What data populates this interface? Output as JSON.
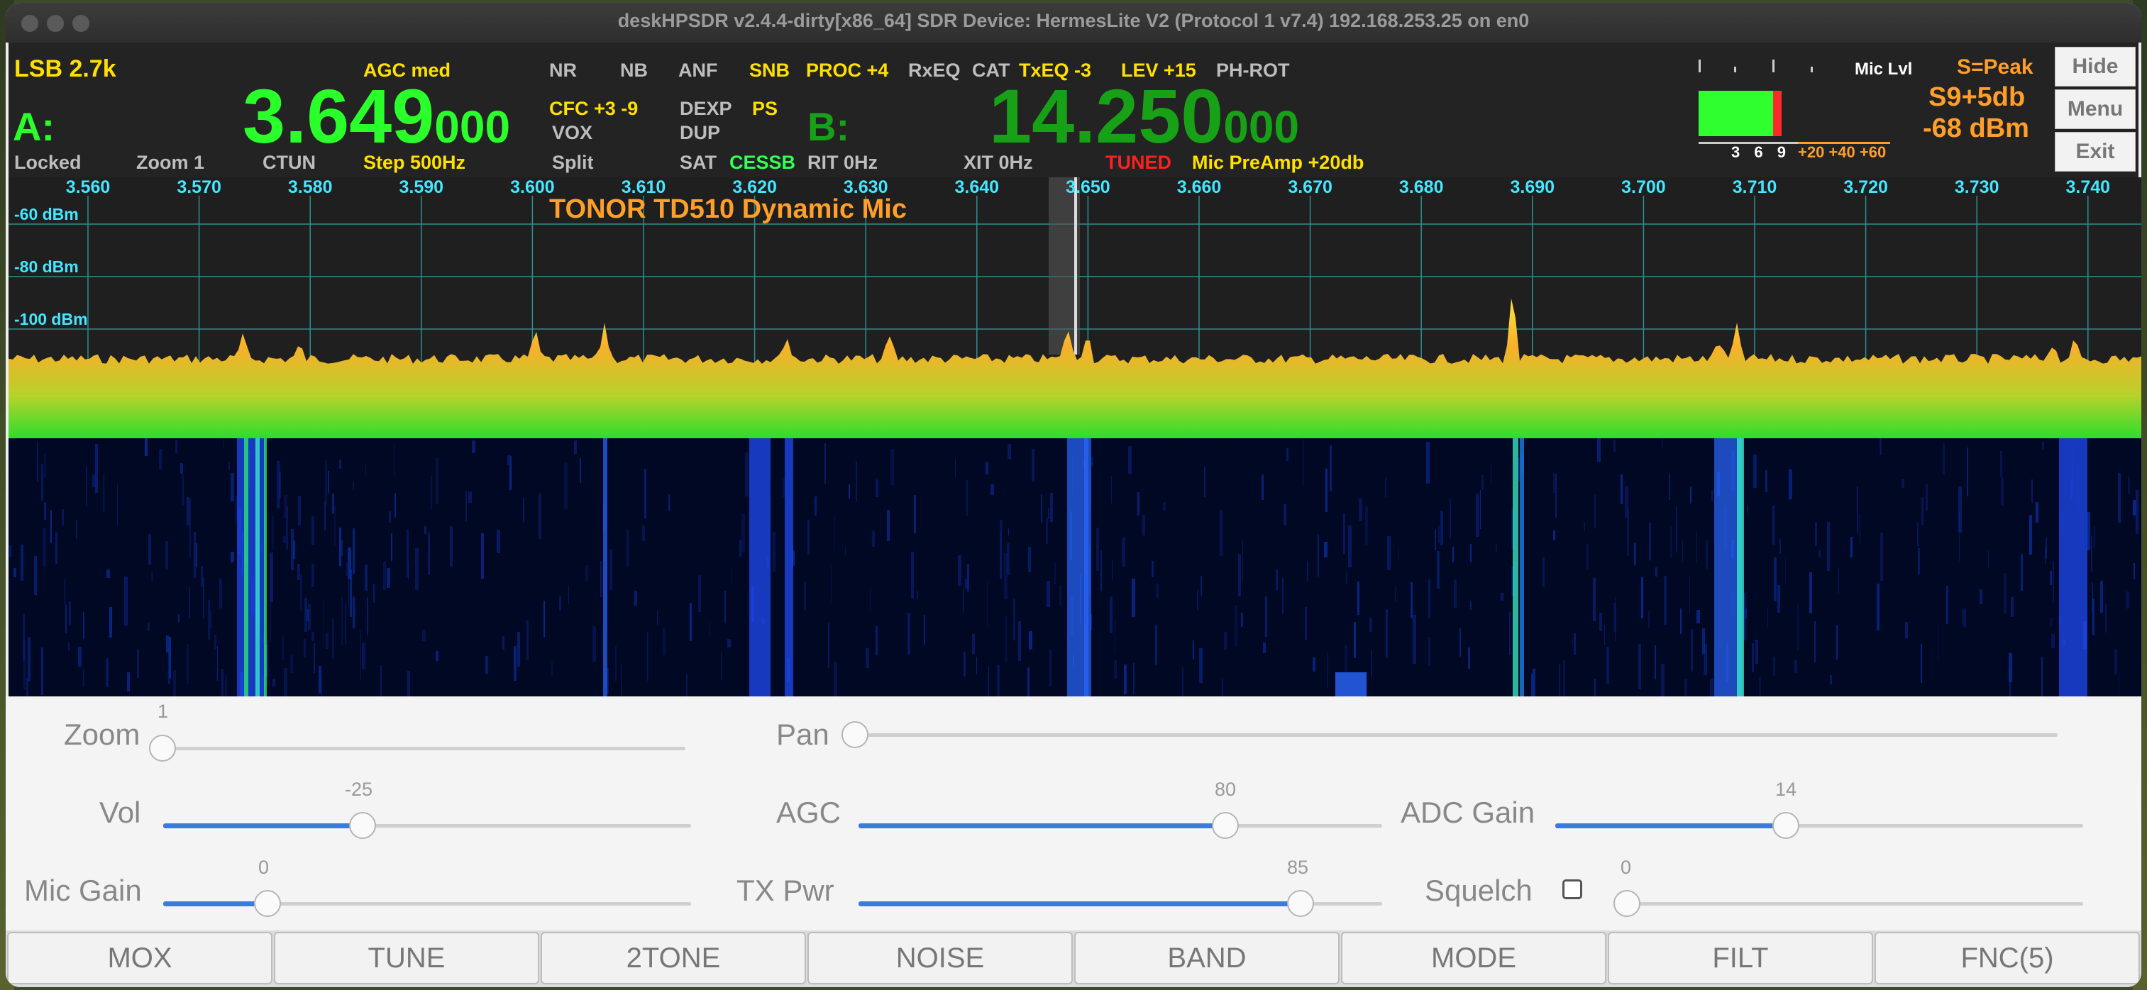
{
  "window": {
    "title": "deskHPSDR v2.4.4-dirty[x86_64] SDR Device: HermesLite V2 (Protocol 1 v7.4) 192.168.253.25 on en0"
  },
  "vfo": {
    "mode": "LSB 2.7k",
    "a_label": "A:",
    "a_freq_main": "3.649",
    "a_freq_sub": "000",
    "b_label": "B:",
    "b_freq_main": "14.250",
    "b_freq_sub": "000",
    "locked": "Locked",
    "zoom": "Zoom 1",
    "ctun": "CTUN",
    "step": "Step 500Hz",
    "agc": "AGC med",
    "nr": "NR",
    "nb": "NB",
    "anf": "ANF",
    "snb": "SNB",
    "proc": "PROC +4",
    "rxeq": "RxEQ",
    "cat": "CAT",
    "txeq": "TxEQ -3",
    "lev": "LEV +15",
    "phrot": "PH-ROT",
    "cfc": "CFC +3 -9",
    "vox": "VOX",
    "dexp": "DEXP",
    "ps": "PS",
    "dup": "DUP",
    "split": "Split",
    "sat": "SAT",
    "cessb": "CESSB",
    "rit": "RIT 0Hz",
    "xit": "XIT 0Hz",
    "tuned": "TUNED",
    "micpreamp": "Mic PreAmp +20db"
  },
  "meter": {
    "mic_lvl_label": "Mic Lvl",
    "s_mode": "S=Peak",
    "s_reading": "S9+5db",
    "dbm": "-68 dBm",
    "scale_white": "3  6  9",
    "scale_orange": "+20 +40 +60",
    "level_fraction": 0.95
  },
  "side_buttons": {
    "hide": "Hide",
    "menu": "Menu",
    "exit": "Exit"
  },
  "panadapter": {
    "freq_ticks": [
      "3.560",
      "3.570",
      "3.580",
      "3.590",
      "3.600",
      "3.610",
      "3.620",
      "3.630",
      "3.640",
      "3.650",
      "3.660",
      "3.670",
      "3.680",
      "3.690",
      "3.700",
      "3.710",
      "3.720",
      "3.730",
      "3.740"
    ],
    "db_labels": [
      "-60 dBm",
      "-80 dBm",
      "-100 dBm"
    ],
    "mic_name": "TONOR TD510 Dynamic Mic"
  },
  "sliders": {
    "zoom": {
      "label": "Zoom",
      "value": "1"
    },
    "pan": {
      "label": "Pan"
    },
    "vol": {
      "label": "Vol",
      "value": "-25"
    },
    "agc": {
      "label": "AGC",
      "value": "80"
    },
    "adc": {
      "label": "ADC Gain",
      "value": "14"
    },
    "mic": {
      "label": "Mic Gain",
      "value": "0"
    },
    "txpwr": {
      "label": "TX Pwr",
      "value": "85"
    },
    "squelch": {
      "label": "Squelch",
      "value": "0"
    }
  },
  "buttons": [
    "MOX",
    "TUNE",
    "2TONE",
    "NOISE",
    "BAND",
    "MODE",
    "FILT",
    "FNC(5)"
  ]
}
